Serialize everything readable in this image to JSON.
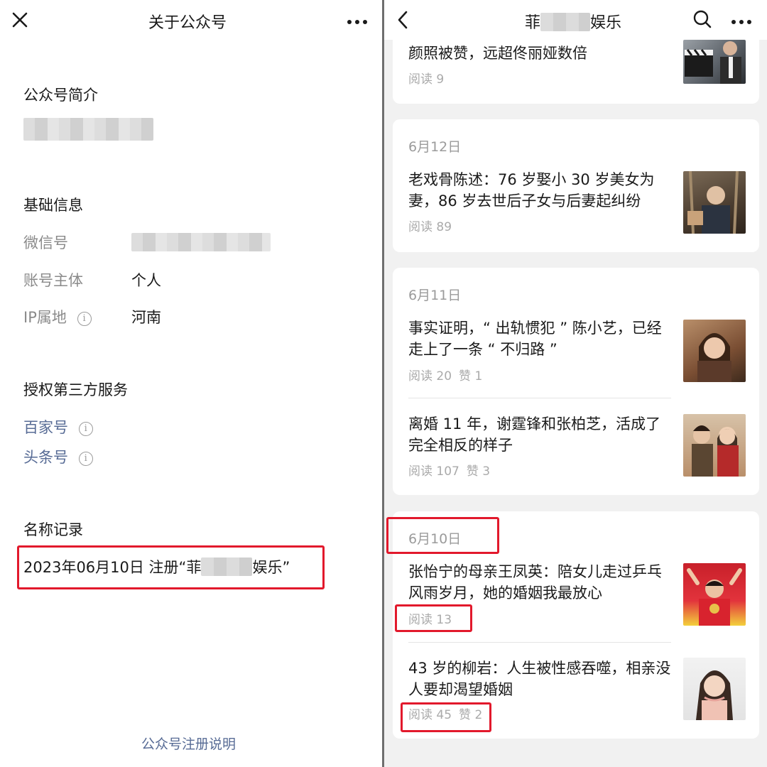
{
  "left": {
    "header": {
      "title": "关于公众号",
      "close_icon": "close-icon",
      "more_icon": "more-icon"
    },
    "intro": {
      "heading": "公众号简介"
    },
    "basic": {
      "heading": "基础信息",
      "rows": [
        {
          "label": "微信号",
          "value": ""
        },
        {
          "label": "账号主体",
          "value": "个人"
        },
        {
          "label": "IP属地",
          "value": "河南"
        }
      ]
    },
    "third_party": {
      "heading": "授权第三方服务",
      "items": [
        "百家号",
        "头条号"
      ]
    },
    "name_record": {
      "heading": "名称记录",
      "entry_prefix": "2023年06月10日 注册“菲",
      "entry_suffix": "娱乐”"
    },
    "footer_link": "公众号注册说明"
  },
  "right": {
    "header": {
      "title_prefix": "菲",
      "title_suffix": "娱乐",
      "back_icon": "back-chevron-icon",
      "search_icon": "search-icon",
      "more_icon": "more-icon"
    },
    "cards": [
      {
        "date": "",
        "articles": [
          {
            "title": "颜照被赞，远超佟丽娅数倍",
            "reads": "阅读 9",
            "likes": "",
            "thumb": "clapperboard-photo"
          }
        ]
      },
      {
        "date": "6月12日",
        "articles": [
          {
            "title": "老戏骨陈述：76 岁娶小 30 岁美女为妻，86 岁去世后子女与后妻起纠纷",
            "reads": "阅读 89",
            "likes": "",
            "thumb": "old-man-photo"
          }
        ]
      },
      {
        "date": "6月11日",
        "articles": [
          {
            "title": "事实证明，“ 出轨惯犯 ” 陈小艺，已经走上了一条 “ 不归路 ”",
            "reads": "阅读 20",
            "likes": "赞 1",
            "thumb": "woman-photo"
          },
          {
            "title": "离婚 11 年，谢霆锋和张柏芝，活成了完全相反的样子",
            "reads": "阅读 107",
            "likes": "赞 3",
            "thumb": "couple-photo"
          }
        ]
      },
      {
        "date": "6月10日",
        "articles": [
          {
            "title": "张怡宁的母亲王凤英：陪女儿走过乒乓风雨岁月，她的婚姻我最放心",
            "reads": "阅读 13",
            "likes": "",
            "thumb": "athlete-photo"
          },
          {
            "title": "43 岁的柳岩：人生被性感吞噬，相亲没人要却渴望婚姻",
            "reads": "阅读 45",
            "likes": "赞 2",
            "thumb": "portrait-photo"
          }
        ]
      }
    ]
  },
  "colors": {
    "link": "#576b95",
    "highlight": "#e2192c",
    "muted": "#9b9b9b",
    "panel_bg": "#f1f1f1"
  }
}
